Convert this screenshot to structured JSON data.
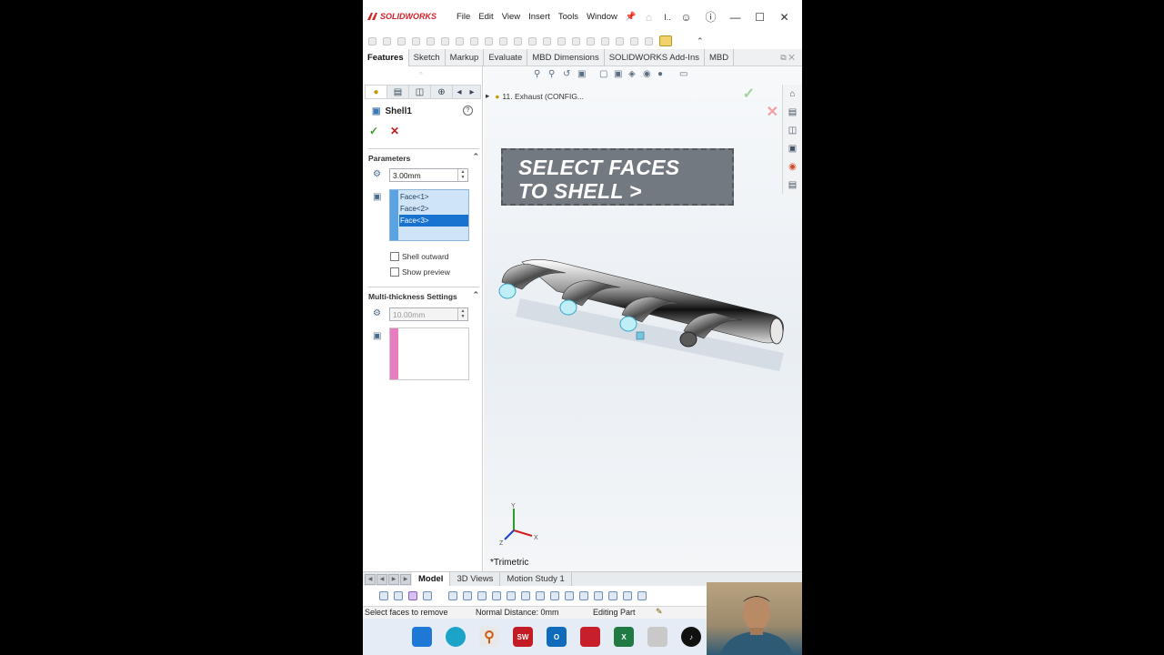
{
  "app": {
    "brand": "SOLIDWORKS",
    "menu": [
      "File",
      "Edit",
      "View",
      "Insert",
      "Tools",
      "Window"
    ],
    "title_short": "I..",
    "colors": {
      "brand_red": "#d2232a",
      "accent_blue": "#1873d0",
      "ok_green": "#3a9a2b",
      "cancel_red": "#c21d1d"
    }
  },
  "command_tabs": [
    "Features",
    "Sketch",
    "Markup",
    "Evaluate",
    "MBD Dimensions",
    "SOLIDWORKS Add-Ins",
    "MBD"
  ],
  "property_manager": {
    "title": "Shell1",
    "parameters": {
      "header": "Parameters",
      "thickness": "3.00mm",
      "faces": [
        "Face<1>",
        "Face<2>",
        "Face<3>"
      ],
      "shell_outward_label": "Shell outward",
      "show_preview_label": "Show preview"
    },
    "multi_thickness": {
      "header": "Multi-thickness Settings",
      "thickness": "10.00mm"
    }
  },
  "viewport": {
    "tree_crumb": "11. Exhaust  (CONFIG...",
    "callout_line1": "SELECT FACES",
    "callout_line2": "TO SHELL >",
    "view_orientation": "*Trimetric",
    "triad_labels": {
      "x": "X",
      "y": "Y",
      "z": "Z"
    }
  },
  "bottom_tabs": [
    "Model",
    "3D Views",
    "Motion Study 1"
  ],
  "status": {
    "prompt": "Select faces to remove",
    "normal_distance": "Normal Distance: 0mm",
    "mode": "Editing Part"
  },
  "taskbar": {
    "icons": [
      "windows-start-icon",
      "edge-icon",
      "search-icon",
      "solidworks-icon",
      "outlook-icon",
      "recorder-icon",
      "excel-icon",
      "notepad-icon",
      "tiktok-icon"
    ]
  }
}
